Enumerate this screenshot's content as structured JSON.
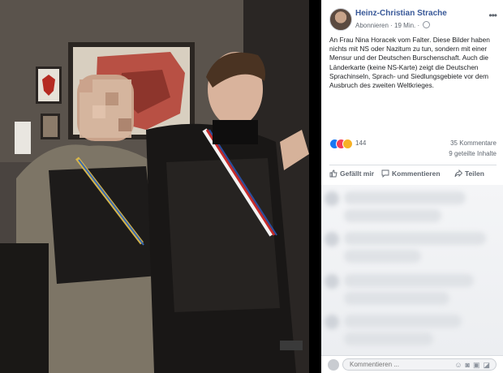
{
  "post": {
    "author": "Heinz-Christian Strache",
    "follow": "Abonnieren",
    "time": "· 19 Min. ·",
    "more": "•••",
    "text": "An Frau Nina Horacek vom Falter. Diese Bilder haben nichts mit NS oder Nazitum zu tun, sondern mit einer Mensur und der Deutschen Burschenschaft. Auch die Länderkarte (keine NS-Karte) zeigt die Deutschen Sprachinseln, Sprach- und Siedlungsgebiete vor dem Ausbruch des zweiten Weltkrieges.",
    "reactions_count": "144",
    "comments_count": "35 Kommentare",
    "shares_count": "9 geteilte Inhalte"
  },
  "actions": {
    "like": "Gefällt mir",
    "comment": "Kommentieren",
    "share": "Teilen"
  },
  "comment_box": {
    "placeholder": "Kommentieren ...",
    "icons": [
      "emoji-icon",
      "camera-icon",
      "gif-icon",
      "sticker-icon"
    ]
  },
  "colors": {
    "link": "#385898",
    "muted": "#606770",
    "like": "#1877f2",
    "love": "#f33e58",
    "haha": "#f7b125"
  }
}
